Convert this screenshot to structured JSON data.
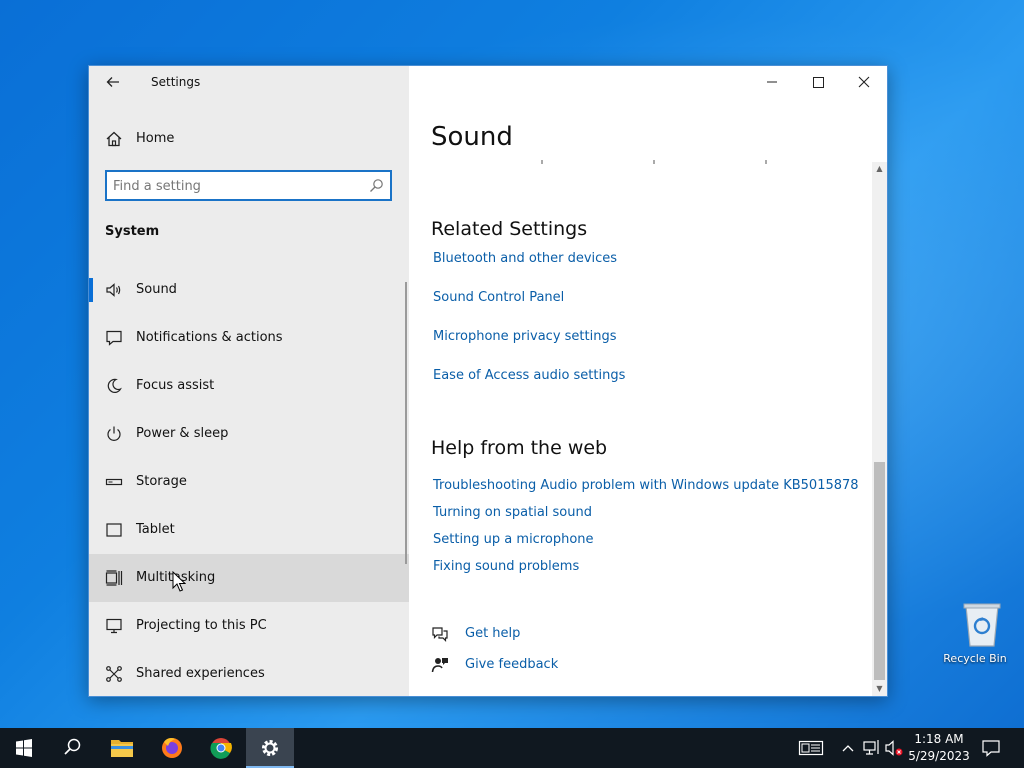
{
  "window": {
    "title": "Settings",
    "back_label": "←"
  },
  "sidebar": {
    "home_label": "Home",
    "search_placeholder": "Find a setting",
    "section_title": "System",
    "items": [
      {
        "label": "Sound",
        "icon": "speaker-icon",
        "selected": true
      },
      {
        "label": "Notifications & actions",
        "icon": "notification-icon"
      },
      {
        "label": "Focus assist",
        "icon": "moon-icon"
      },
      {
        "label": "Power & sleep",
        "icon": "power-icon"
      },
      {
        "label": "Storage",
        "icon": "storage-icon"
      },
      {
        "label": "Tablet",
        "icon": "tablet-icon"
      },
      {
        "label": "Multitasking",
        "icon": "multitasking-icon",
        "hover": true
      },
      {
        "label": "Projecting to this PC",
        "icon": "projector-icon"
      },
      {
        "label": "Shared experiences",
        "icon": "shared-icon"
      }
    ]
  },
  "content": {
    "page_title": "Sound",
    "related_title": "Related Settings",
    "related_links": [
      "Bluetooth and other devices",
      "Sound Control Panel",
      "Microphone privacy settings",
      "Ease of Access audio settings"
    ],
    "help_title": "Help from the web",
    "help_links": [
      "Troubleshooting Audio problem with Windows update KB5015878",
      "Turning on spatial sound",
      "Setting up a microphone",
      "Fixing sound problems"
    ],
    "get_help": "Get help",
    "give_feedback": "Give feedback"
  },
  "desktop": {
    "recycle_bin": "Recycle Bin"
  },
  "taskbar": {
    "time": "1:18 AM",
    "date": "5/29/2023"
  },
  "colors": {
    "accent": "#0a6fd6",
    "link": "#0a5ea8",
    "sidebar_bg": "#ececec",
    "taskbar_bg": "#101820"
  }
}
